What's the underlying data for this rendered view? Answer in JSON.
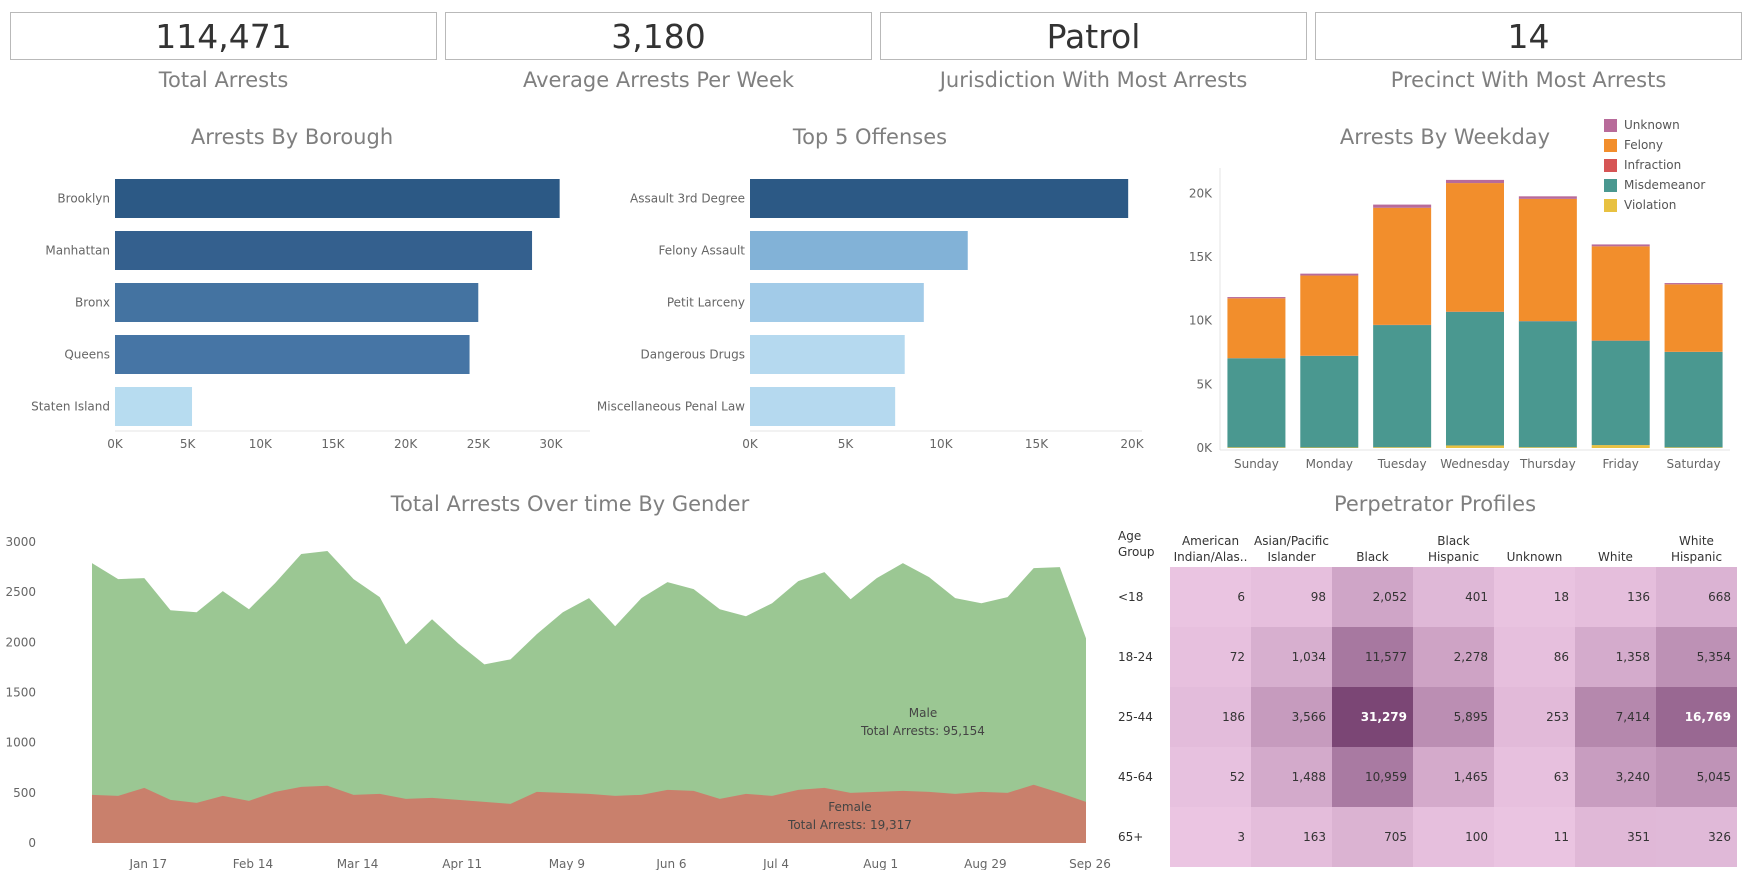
{
  "kpis": [
    {
      "value": "114,471",
      "label": "Total Arrests"
    },
    {
      "value": "3,180",
      "label": "Average Arrests Per Week"
    },
    {
      "value": "Patrol",
      "label": "Jurisdiction With Most Arrests"
    },
    {
      "value": "14",
      "label": "Precinct With Most Arrests"
    }
  ],
  "titles": {
    "borough": "Arrests By Borough",
    "offenses": "Top 5 Offenses",
    "weekday": "Arrests By Weekday",
    "gender": "Total Arrests Over time By Gender",
    "profiles": "Perpetrator Profiles"
  },
  "colors": {
    "borough": [
      "#2c5985",
      "#34608e",
      "#4473a1",
      "#4675a5",
      "#b7dcf0"
    ],
    "offenses": [
      "#2c5985",
      "#82b2d7",
      "#a2cbe8",
      "#b5d9ef",
      "#b5d9ef"
    ],
    "male": "#9bc793",
    "female": "#c9806c",
    "heat_low": "#ecc6e3",
    "heat_high": "#7b4675"
  },
  "chart_data": [
    {
      "type": "bar",
      "orientation": "horizontal",
      "title": "Arrests By Borough",
      "categories": [
        "Brooklyn",
        "Manhattan",
        "Bronx",
        "Queens",
        "Staten Island"
      ],
      "values": [
        30600,
        28700,
        25000,
        24400,
        5300
      ],
      "xlim": [
        0,
        32000
      ],
      "ticks": [
        0,
        5000,
        10000,
        15000,
        20000,
        25000,
        30000
      ],
      "tick_labels": [
        "0K",
        "5K",
        "10K",
        "15K",
        "20K",
        "25K",
        "30K"
      ]
    },
    {
      "type": "bar",
      "orientation": "horizontal",
      "title": "Top 5 Offenses",
      "categories": [
        "Assault 3rd Degree",
        "Felony Assault",
        "Petit Larceny",
        "Dangerous Drugs",
        "Miscellaneous Penal Law"
      ],
      "values": [
        19800,
        11400,
        9100,
        8100,
        7600
      ],
      "xlim": [
        0,
        20000
      ],
      "ticks": [
        0,
        5000,
        10000,
        15000,
        20000
      ],
      "tick_labels": [
        "0K",
        "5K",
        "10K",
        "15K",
        "20K"
      ]
    },
    {
      "type": "bar",
      "stacked": true,
      "title": "Arrests By Weekday",
      "categories": [
        "Sunday",
        "Monday",
        "Tuesday",
        "Wednesday",
        "Thursday",
        "Friday",
        "Saturday"
      ],
      "ylim": [
        0,
        22000
      ],
      "ticks": [
        0,
        5000,
        10000,
        15000,
        20000
      ],
      "tick_labels": [
        "0K",
        "5K",
        "10K",
        "15K",
        "20K"
      ],
      "legend_position": "top-right",
      "series": [
        {
          "name": "Violation",
          "color": "#e8c141",
          "values": [
            50,
            40,
            60,
            200,
            60,
            230,
            50
          ]
        },
        {
          "name": "Misdemeanor",
          "color": "#4a9890",
          "values": [
            7000,
            7200,
            9600,
            10500,
            9900,
            8200,
            7500
          ]
        },
        {
          "name": "Infraction",
          "color": "#d65555",
          "values": [
            10,
            10,
            15,
            15,
            15,
            15,
            10
          ]
        },
        {
          "name": "Felony",
          "color": "#f28e2c",
          "values": [
            4700,
            6300,
            9200,
            10100,
            9600,
            7400,
            5300
          ]
        },
        {
          "name": "Unknown",
          "color": "#b86b9a",
          "values": [
            100,
            150,
            250,
            250,
            200,
            150,
            100
          ]
        }
      ],
      "legend": [
        "Unknown",
        "Felony",
        "Infraction",
        "Misdemeanor",
        "Violation"
      ]
    },
    {
      "type": "area",
      "stacked": true,
      "title": "Total Arrests Over time By Gender",
      "ylim": [
        0,
        3000
      ],
      "yticks": [
        0,
        500,
        1000,
        1500,
        2000,
        2500,
        3000
      ],
      "x_tick_labels": [
        "Jan 17",
        "Feb 14",
        "Mar 14",
        "Apr 11",
        "May 9",
        "Jun 6",
        "Jul 4",
        "Aug 1",
        "Aug 29",
        "Sep 26"
      ],
      "x_tick_weeks": [
        2,
        6,
        10,
        14,
        18,
        22,
        26,
        30,
        34,
        38
      ],
      "series": [
        {
          "name": "Female",
          "annotation": [
            "Female",
            "Total Arrests: 19,317"
          ],
          "values": [
            480,
            470,
            550,
            430,
            400,
            470,
            420,
            510,
            560,
            570,
            480,
            490,
            440,
            450,
            430,
            410,
            390,
            510,
            500,
            490,
            470,
            480,
            530,
            520,
            440,
            490,
            470,
            530,
            550,
            500,
            510,
            520,
            510,
            490,
            510,
            500,
            580,
            500,
            410
          ]
        },
        {
          "name": "Male",
          "annotation": [
            "Male",
            "Total Arrests: 95,154"
          ],
          "values": [
            2790,
            2630,
            2640,
            2320,
            2300,
            2510,
            2330,
            2590,
            2880,
            2910,
            2630,
            2450,
            1980,
            2230,
            1990,
            1780,
            1830,
            2080,
            2300,
            2440,
            2160,
            2440,
            2600,
            2530,
            2330,
            2260,
            2390,
            2610,
            2700,
            2430,
            2640,
            2790,
            2650,
            2440,
            2390,
            2450,
            2740,
            2750,
            2040
          ]
        }
      ]
    },
    {
      "type": "heatmap",
      "title": "Perpetrator Profiles",
      "row_header": [
        "Age",
        "Group"
      ],
      "columns": [
        [
          "American",
          "Indian/Alas.."
        ],
        [
          "Asian/Pacific",
          "Islander"
        ],
        [
          "Black"
        ],
        [
          "Black",
          "Hispanic"
        ],
        [
          "Unknown"
        ],
        [
          "White"
        ],
        [
          "White",
          "Hispanic"
        ]
      ],
      "rows": [
        "<18",
        "18-24",
        "25-44",
        "45-64",
        "65+"
      ],
      "values": [
        [
          6,
          98,
          2052,
          401,
          18,
          136,
          668
        ],
        [
          72,
          1034,
          11577,
          2278,
          86,
          1358,
          5354
        ],
        [
          186,
          3566,
          31279,
          5895,
          253,
          7414,
          16769
        ],
        [
          52,
          1488,
          10959,
          1465,
          63,
          3240,
          5045
        ],
        [
          3,
          163,
          705,
          100,
          11,
          351,
          326
        ]
      ],
      "labels": [
        [
          "6",
          "98",
          "2,052",
          "401",
          "18",
          "136",
          "668"
        ],
        [
          "72",
          "1,034",
          "11,577",
          "2,278",
          "86",
          "1,358",
          "5,354"
        ],
        [
          "186",
          "3,566",
          "31,279",
          "5,895",
          "253",
          "7,414",
          "16,769"
        ],
        [
          "52",
          "1,488",
          "10,959",
          "1,465",
          "63",
          "3,240",
          "5,045"
        ],
        [
          "3",
          "163",
          "705",
          "100",
          "11",
          "351",
          "326"
        ]
      ]
    }
  ]
}
